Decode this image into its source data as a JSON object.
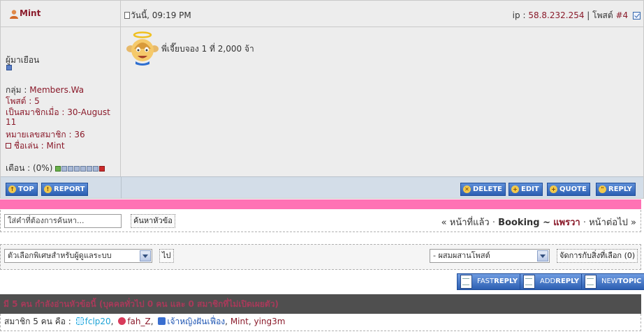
{
  "post": {
    "username": "Mint",
    "date": "วันนี้, 09:19 PM",
    "ip_label": "ip :",
    "ip": "58.8.232.254",
    "post_label": "โพสต์",
    "post_no": "#4",
    "rank": "ผู้มาเยือน",
    "group_label": "กลุ่ม :",
    "group": "Members.Wa",
    "posts_label": "โพสต์ :",
    "posts": "5",
    "joined_line1": "เป็นสมาชิกเมื่อ : 30-August",
    "joined_line2": "11",
    "member_no_label": "หมายเลขสมาชิก :",
    "member_no": "36",
    "nick_label": "ชื่อเล่น :",
    "nick": "Mint",
    "warn_label": "เตือน : (0%)",
    "warn_level": 0,
    "message": "พี่เจี๊ยบจอง 1 ที่ 2,000 จ้า"
  },
  "post_buttons": {
    "top": "TOP",
    "report": "REPORT",
    "delete": "DELETE",
    "edit": "EDIT",
    "quote": "QUOTE",
    "reply": "REPLY"
  },
  "search": {
    "placeholder": "ใส่คำที่ต้องการค้นหา...",
    "button": "ค้นหาหัวข้อ"
  },
  "topic_nav": {
    "prev": "« หน้าที่แล้ว",
    "sep1": "·",
    "topic": "Booking ~",
    "forum": "แพรวา",
    "sep2": "·",
    "next": "หน้าต่อไป »"
  },
  "admin": {
    "mod_select": "ตัวเลือกพิเศษสำหรับผู้ดูแลระบบ",
    "go": "ไป",
    "merge_select": "- ผสมผสานโพสต์",
    "apply": "จัดการกับสิ่งที่เลือก (0)"
  },
  "reply_buttons": {
    "fast_prefix": "FAST",
    "fast_bold": "REPLY",
    "add_prefix": "ADD",
    "add_bold": "REPLY",
    "new_prefix": "NEW",
    "new_bold": "TOPIC"
  },
  "online": {
    "heading": "มี 5 คน กำลังอ่านหัวข้อนี้ (บุคคลทั่วไป 0 คน และ 0 สมาชิกที่ไม่เปิดเผยตัว)",
    "members_label": "สมาชิก 5 คน คือ :",
    "u1": "fclp20",
    "u2": "fah_Z",
    "u3": "เจ้าหญิงฝันเฟื่อง",
    "u4": "Mint",
    "u5": "ying3m",
    "comma": ","
  },
  "colors": {
    "pink_bar": "#ff72b4",
    "username": "#8a1a2a",
    "button_blue": "#2c5fb3"
  }
}
